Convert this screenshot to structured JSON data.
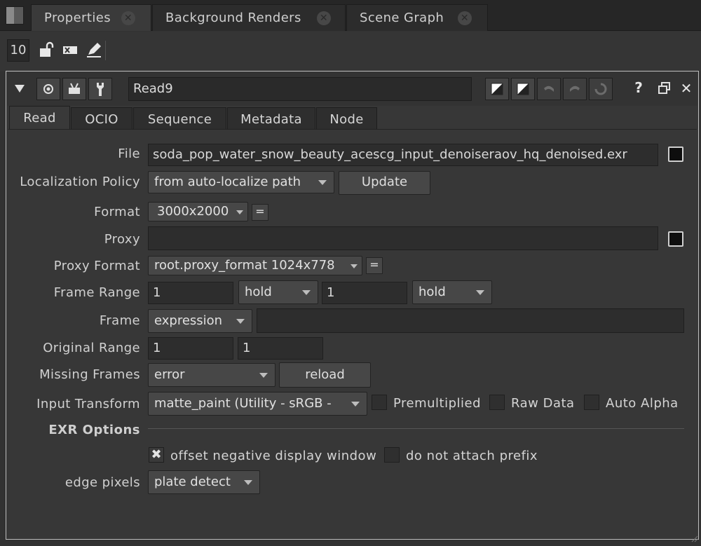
{
  "panel_tabs": [
    {
      "label": "Properties"
    },
    {
      "label": "Background Renders"
    },
    {
      "label": "Scene Graph"
    }
  ],
  "toolbar": {
    "node_count": "10"
  },
  "node": {
    "name": "Read9",
    "tabs": [
      "Read",
      "OCIO",
      "Sequence",
      "Metadata",
      "Node"
    ],
    "help_glyph": "?"
  },
  "knobs": {
    "file": {
      "label": "File",
      "value": "soda_pop_water_snow_beauty_acescg_input_denoiseraov_hq_denoised.exr"
    },
    "localization": {
      "label": "Localization Policy",
      "value": "from auto-localize path",
      "update": "Update"
    },
    "format": {
      "label": "Format",
      "value": "3000x2000",
      "eq": "="
    },
    "proxy": {
      "label": "Proxy",
      "value": ""
    },
    "proxy_format": {
      "label": "Proxy Format",
      "value": "root.proxy_format 1024x778",
      "eq": "="
    },
    "frame_range": {
      "label": "Frame Range",
      "first": "1",
      "before": "hold",
      "last": "1",
      "after": "hold"
    },
    "frame": {
      "label": "Frame",
      "mode": "expression",
      "value": ""
    },
    "original_range": {
      "label": "Original Range",
      "first": "1",
      "last": "1"
    },
    "missing_frames": {
      "label": "Missing Frames",
      "value": "error",
      "reload": "reload"
    },
    "input_transform": {
      "label": "Input Transform",
      "value": "matte_paint (Utility - sRGB -",
      "premultiplied": "Premultiplied",
      "raw_data": "Raw Data",
      "auto_alpha": "Auto Alpha"
    },
    "exr_options": {
      "label": "EXR Options"
    },
    "offset_negative": {
      "label": "offset negative display window",
      "checked": true
    },
    "no_prefix": {
      "label": "do not attach prefix",
      "checked": false
    },
    "edge_pixels": {
      "label": "edge pixels",
      "value": "plate detect"
    }
  }
}
